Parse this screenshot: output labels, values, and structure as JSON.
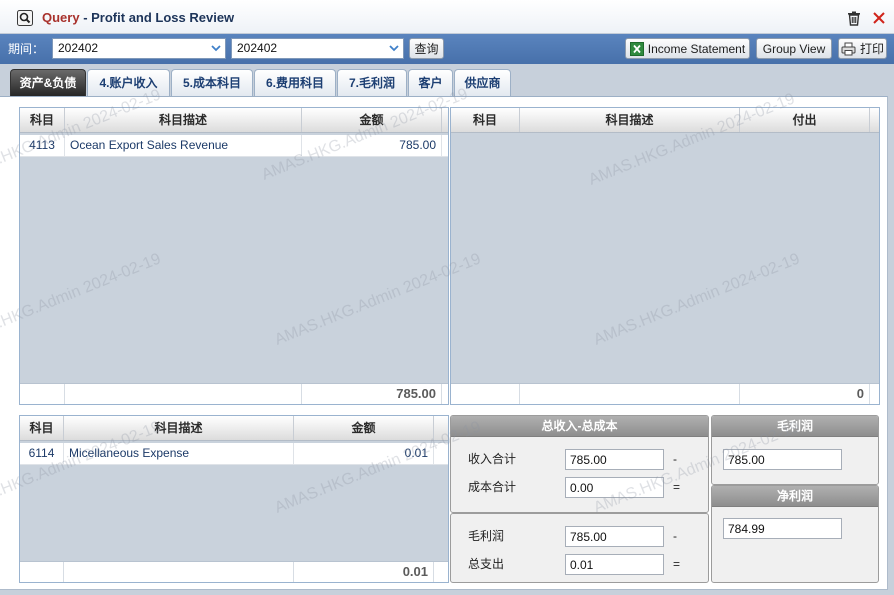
{
  "window": {
    "title_prefix": "Query",
    "title_separator": " - ",
    "title": "Profit and Loss Review"
  },
  "toolbar": {
    "period_label": "期间：",
    "period_from": "202402",
    "period_to": "202402",
    "query_label": "查询",
    "income_statement_label": "Income Statement",
    "group_view_label": "Group View",
    "print_label": "打印"
  },
  "tabs": [
    {
      "label": "资产&负债",
      "active": true
    },
    {
      "label": "4.账户收入",
      "active": false
    },
    {
      "label": "5.成本科目",
      "active": false
    },
    {
      "label": "6.费用科目",
      "active": false
    },
    {
      "label": "7.毛利润",
      "active": false
    },
    {
      "label": "客户",
      "active": false
    },
    {
      "label": "供应商",
      "active": false
    }
  ],
  "income_grid": {
    "columns": [
      "科目",
      "科目描述",
      "金额"
    ],
    "rows": [
      {
        "code": "4113",
        "description": "Ocean Export Sales Revenue",
        "amount": "785.00"
      }
    ],
    "total": "785.00"
  },
  "payout_grid": {
    "columns": [
      "科目",
      "科目描述",
      "付出"
    ],
    "rows": [],
    "total": "0"
  },
  "expense_grid": {
    "columns": [
      "科目",
      "科目描述",
      "金额"
    ],
    "rows": [
      {
        "code": "6114",
        "description": "Micellaneous Expense",
        "amount": "0.01"
      }
    ],
    "total": "0.01"
  },
  "summary": {
    "title": "总收入-总成本",
    "income_total_label": "收入合计",
    "income_total": "785.00",
    "cost_total_label": "成本合计",
    "cost_total": "0.00",
    "gross_profit_label": "毛利润",
    "gross_profit": "785.00",
    "total_expense_label": "总支出",
    "total_expense": "0.01",
    "minus_sign": "-",
    "equals_sign": "="
  },
  "gross_profit_panel": {
    "title": "毛利润",
    "value": "785.00"
  },
  "net_profit_panel": {
    "title": "净利润",
    "value": "784.99"
  },
  "watermark": "AMAS.HKG.Admin 2024-02-19",
  "icons": {
    "window": "magnifier-icon",
    "delete": "trash-icon",
    "close": "close-icon",
    "dropdown": "chevron-down-icon",
    "export": "excel-icon",
    "print": "printer-icon"
  },
  "colors": {
    "toolbar": "#4f79b3",
    "title_prefix": "#a8312c",
    "title": "#1d3459",
    "active_tab": "#2f2f2f",
    "tab_text": "#1d3f73",
    "grid_empty": "#c9d2dc",
    "panel_header": "#999999",
    "close": "#d0241b"
  }
}
